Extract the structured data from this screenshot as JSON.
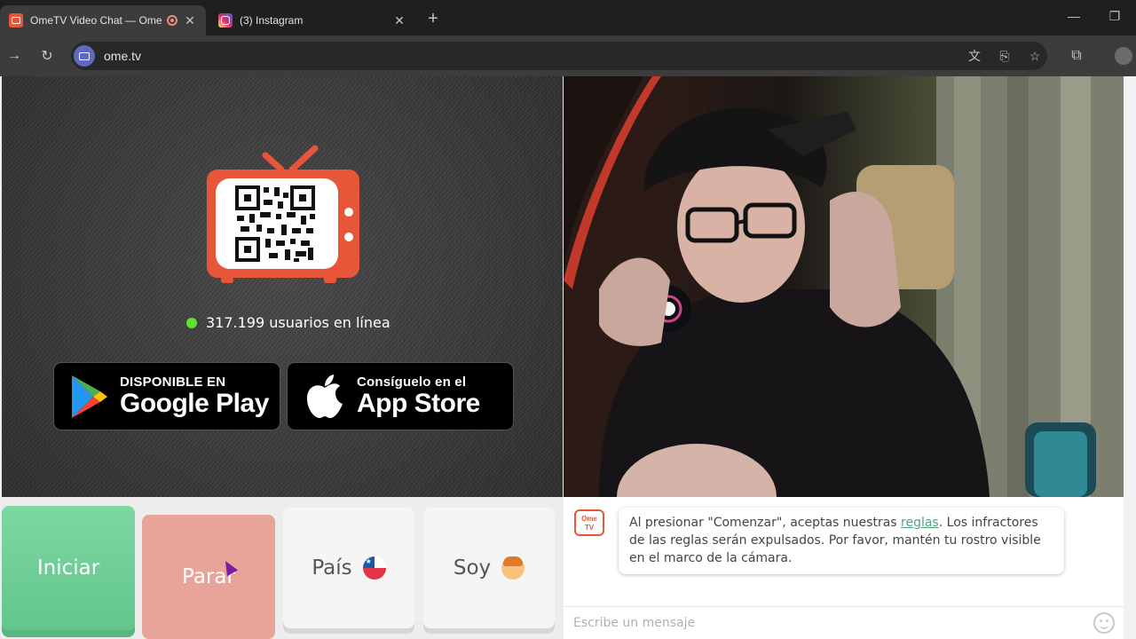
{
  "browser": {
    "tabs": [
      {
        "title": "OmeTV Video Chat — Ome",
        "active": true,
        "recording": true
      },
      {
        "title": "(3) Instagram",
        "active": false
      }
    ],
    "new_tab": "+",
    "close_glyph": "✕",
    "url": "ome.tv",
    "window_controls": {
      "minimize": "—",
      "restore": "❐"
    }
  },
  "left_panel": {
    "online_count": "317.199 usuarios en línea",
    "google_play": {
      "small": "DISPONIBLE EN",
      "big": "Google Play"
    },
    "app_store": {
      "small": "Consíguelo en el",
      "big": "App Store"
    }
  },
  "controls": {
    "start_label": "Iniciar",
    "stop_label": "Parar",
    "country_label": "País",
    "gender_label": "Soy"
  },
  "chat": {
    "logo_top": "Ome",
    "logo_bottom": "TV",
    "message_before": "Al presionar \"Comenzar\", aceptas nuestras ",
    "message_link": "reglas",
    "message_after": ". Los infractores de las reglas serán expulsados. Por favor, mantén tu rostro visible en el marco de la cámara.",
    "input_placeholder": "Escribe un mensaje"
  },
  "colors": {
    "brand": "#e8563a",
    "start_green": "#6fcf97",
    "stop_red": "#e8a498",
    "online_dot": "#5be32d",
    "link_green": "#4fa57a"
  }
}
